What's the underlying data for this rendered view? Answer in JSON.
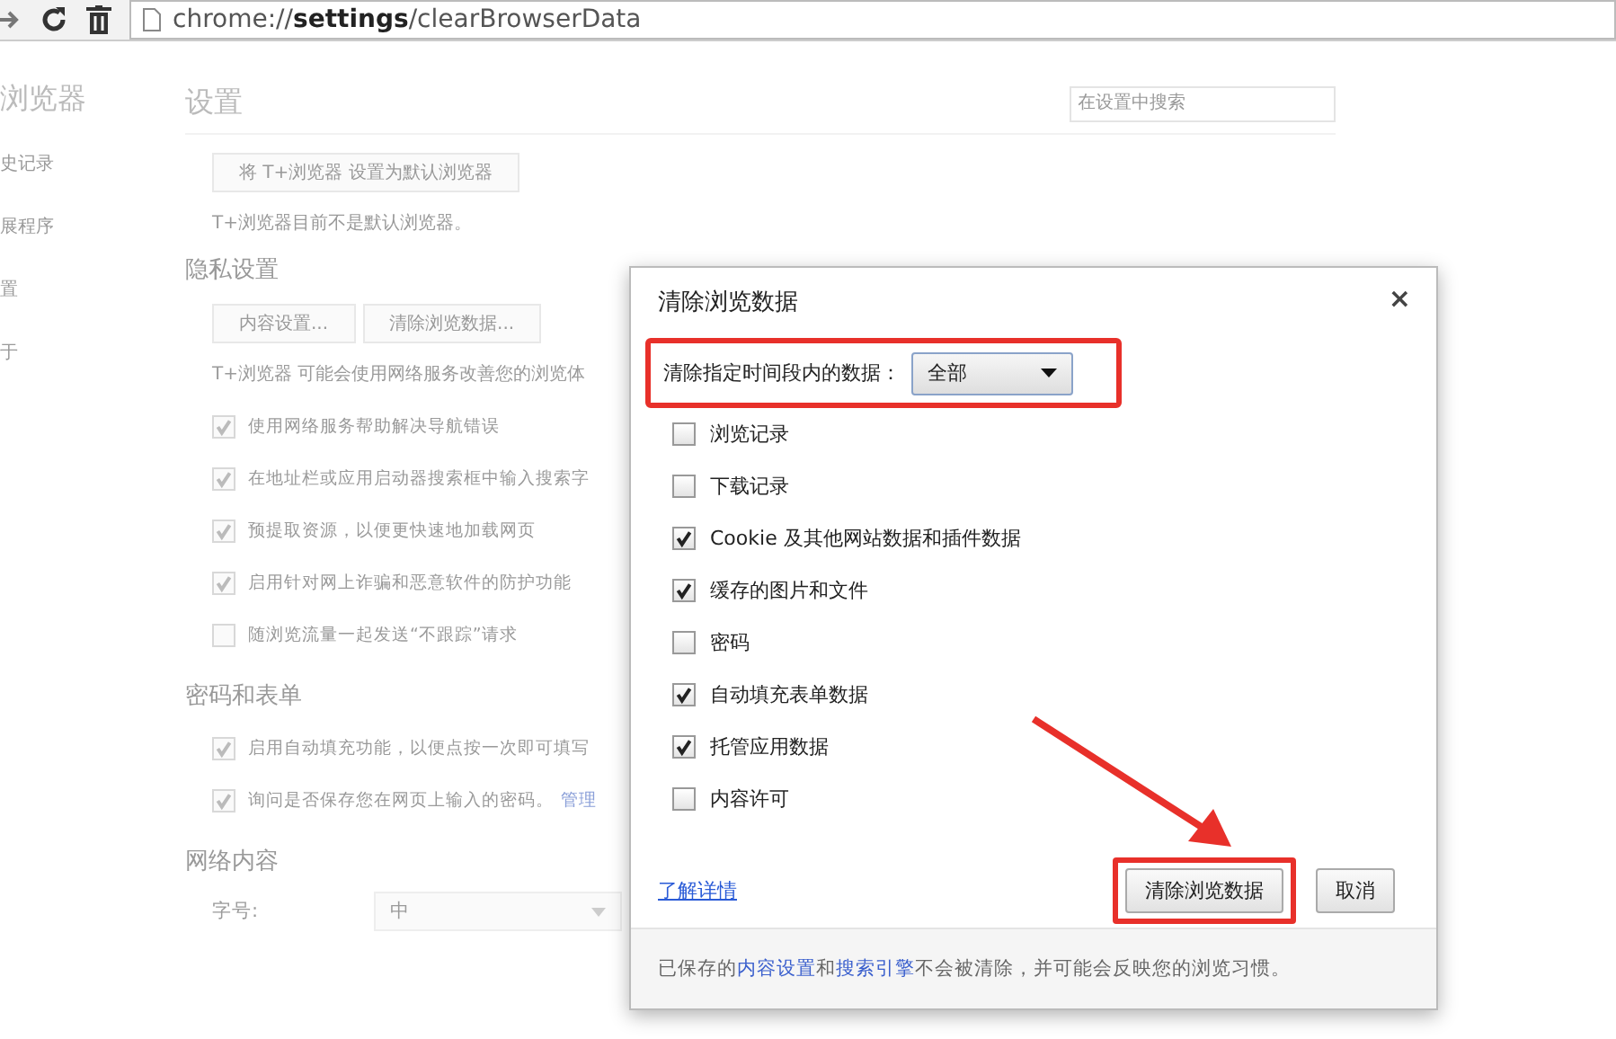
{
  "toolbar": {
    "url": "chrome://**settings**/clearBrowserData"
  },
  "sidebar": {
    "title": "浏览器",
    "items": [
      "史记录",
      "展程序",
      "置",
      "于"
    ]
  },
  "settings": {
    "title": "设置",
    "search": {
      "placeholder": "在设置中搜索"
    },
    "sections": [
      {
        "items": [
          {
            "kind": "buttons",
            "buttons": [
              "将 T+浏览器 设置为默认浏览器"
            ]
          },
          {
            "kind": "note",
            "text": "T+浏览器目前不是默认浏览器。"
          }
        ]
      },
      {
        "heading": "隐私设置",
        "items": [
          {
            "kind": "buttons",
            "buttons": [
              "内容设置...",
              "清除浏览数据..."
            ]
          },
          {
            "kind": "note",
            "text": "T+浏览器 可能会使用网络服务改善您的浏览体"
          },
          {
            "kind": "checkbox",
            "label": "使用网络服务帮助解决导航错误",
            "checked": true
          },
          {
            "kind": "checkbox",
            "label": "在地址栏或应用启动器搜索框中输入搜索字",
            "checked": true
          },
          {
            "kind": "checkbox",
            "label": "预提取资源，以便更快速地加载网页",
            "checked": true
          },
          {
            "kind": "checkbox",
            "label": "启用针对网上诈骗和恶意软件的防护功能",
            "checked": true
          },
          {
            "kind": "checkbox",
            "label": "随浏览流量一起发送“不跟踪”请求",
            "checked": false
          }
        ]
      },
      {
        "heading": "密码和表单",
        "items": [
          {
            "kind": "checkbox",
            "label": "启用自动填充功能，以便点按一次即可填写",
            "checked": true
          },
          {
            "kind": "checkbox",
            "label": "询问是否保存您在网页上输入的密码。",
            "link": "管理",
            "checked": true
          }
        ]
      },
      {
        "heading": "网络内容",
        "items": [
          {
            "kind": "select",
            "label": "字号:",
            "value": "中"
          }
        ]
      }
    ]
  },
  "dialog": {
    "title": "清除浏览数据",
    "close": "×",
    "range": {
      "label": "清除指定时间段内的数据：",
      "value": "全部",
      "highlighted": true
    },
    "options": [
      {
        "label": "浏览记录",
        "checked": false
      },
      {
        "label": "下载记录",
        "checked": false
      },
      {
        "label": "Cookie 及其他网站数据和插件数据",
        "checked": true
      },
      {
        "label": "缓存的图片和文件",
        "checked": true
      },
      {
        "label": "密码",
        "checked": false
      },
      {
        "label": "自动填充表单数据",
        "checked": true
      },
      {
        "label": "托管应用数据",
        "checked": true
      },
      {
        "label": "内容许可",
        "checked": false
      }
    ],
    "link": "了解详情",
    "buttons": [
      {
        "label": "清除浏览数据",
        "highlighted": true
      },
      {
        "label": "取消",
        "highlighted": false
      }
    ],
    "footer": [
      {
        "text": "已保存的",
        "link": false
      },
      {
        "text": "内容设置",
        "link": true
      },
      {
        "text": "和",
        "link": false
      },
      {
        "text": "搜索引擎",
        "link": true
      },
      {
        "text": "不会被清除，并可能会反映您的浏览习惯。",
        "link": false
      }
    ]
  }
}
